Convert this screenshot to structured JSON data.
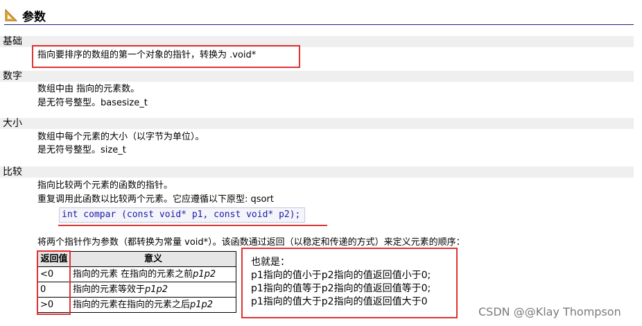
{
  "header": {
    "title": "参数",
    "icon": "ruler-triangle-icon"
  },
  "sections": [
    {
      "term": "基础",
      "lines": [
        "指向要排序的数组的第一个对象的指针，转换为 .void*"
      ]
    },
    {
      "term": "数字",
      "lines": [
        "数组中由 指向的元素数。",
        "是无符号整型。basesize_t"
      ]
    },
    {
      "term": "大小",
      "lines": [
        "数组中每个元素的大小（以字节为单位）。",
        "是无符号整型。size_t"
      ]
    },
    {
      "term": "比较",
      "lines": [
        "指向比较两个元素的函数的指针。",
        "重复调用此函数以比较两个元素。它应遵循以下原型: qsort"
      ]
    }
  ],
  "code": "int compar (const void* p1, const void* p2);",
  "description": "将两个指针作为参数（都转换为常量 void*）。该函数通过返回（以稳定和传递的方式）来定义元素的顺序：",
  "table": {
    "headers": [
      "返回值",
      "意义"
    ],
    "rows": [
      {
        "ret": "<0",
        "desc": "指向的元素 在指向的元素之前",
        "desc_it": "p1p2"
      },
      {
        "ret": "0",
        "desc": "指向的元素等效于",
        "desc_it": "p1p2"
      },
      {
        "ret": ">0",
        "desc": "指向的元素在指向的元素之后",
        "desc_it": "p1p2"
      }
    ]
  },
  "note": {
    "lines": [
      "也就是：",
      "p1指向的值小于p2指向的值返回值小于0;",
      "p1指向的值等于p2指向的值返回值等于0;",
      "p1指向的值大于p2指向的值返回值大于0"
    ]
  },
  "watermark": "CSDN @@Klay Thompson",
  "colors": {
    "highlight": "#e03131",
    "rule": "#1f1f7a",
    "code": "#1a1aa6"
  }
}
